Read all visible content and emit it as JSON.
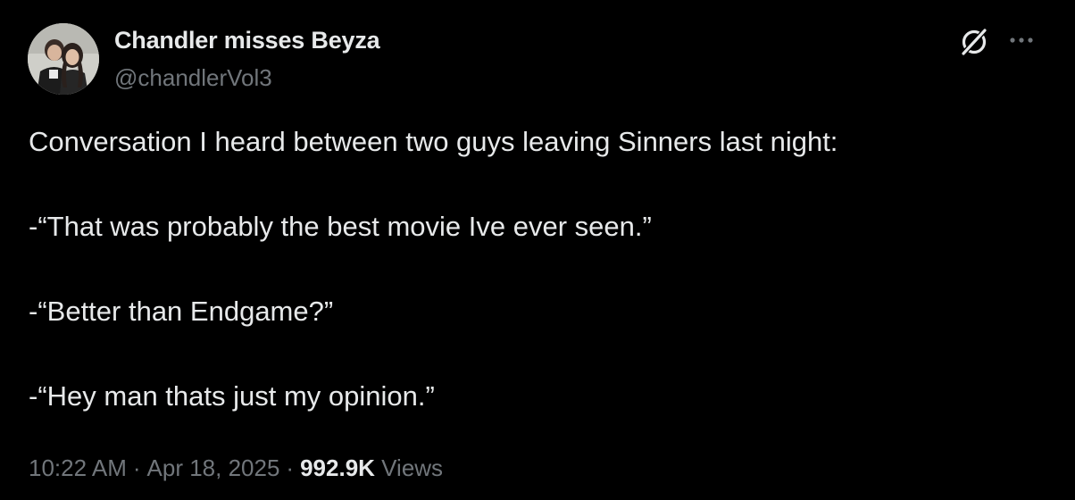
{
  "author": {
    "display_name": "Chandler misses Beyza",
    "handle": "@chandlerVol3"
  },
  "tweet": {
    "paragraphs": [
      "Conversation I heard between two guys leaving Sinners last night:",
      "-“That was probably the best movie Ive ever seen.”",
      "-“Better than Endgame?”",
      "-“Hey man thats just my opinion.”"
    ]
  },
  "meta": {
    "time": "10:22 AM",
    "separator": "·",
    "date": "Apr 18, 2025",
    "views_count": "992.9K",
    "views_label": "Views"
  },
  "actions": {
    "grok_icon": "grok-icon",
    "more_icon": "more-horizontal-icon"
  },
  "colors": {
    "background": "#000000",
    "primary_text": "#e7e9ea",
    "secondary_text": "#71767b"
  }
}
